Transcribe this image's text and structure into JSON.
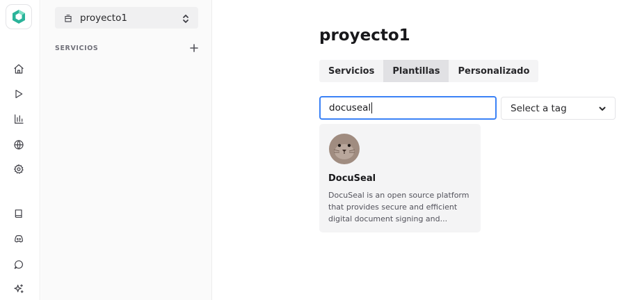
{
  "rail": {
    "icons": [
      "home-icon",
      "play-icon",
      "bar-chart-icon",
      "globe-icon",
      "settings-icon",
      "book-icon",
      "discord-icon",
      "chat-icon",
      "sparkle-icon"
    ]
  },
  "sidebar": {
    "project_name": "proyecto1",
    "section_label": "SERVICIOS"
  },
  "main": {
    "title": "proyecto1",
    "tabs": [
      {
        "label": "Servicios",
        "active": false
      },
      {
        "label": "Plantillas",
        "active": true
      },
      {
        "label": "Personalizado",
        "active": false
      }
    ],
    "search": {
      "value": "docuseal"
    },
    "tag_select": {
      "selected": "Select a tag"
    },
    "templates": [
      {
        "title": "DocuSeal",
        "description": "DocuSeal is an open source platform that provides secure and efficient digital document signing and..."
      }
    ]
  },
  "colors": {
    "accent": "#3b82f6",
    "logo": "#2bb39a"
  }
}
